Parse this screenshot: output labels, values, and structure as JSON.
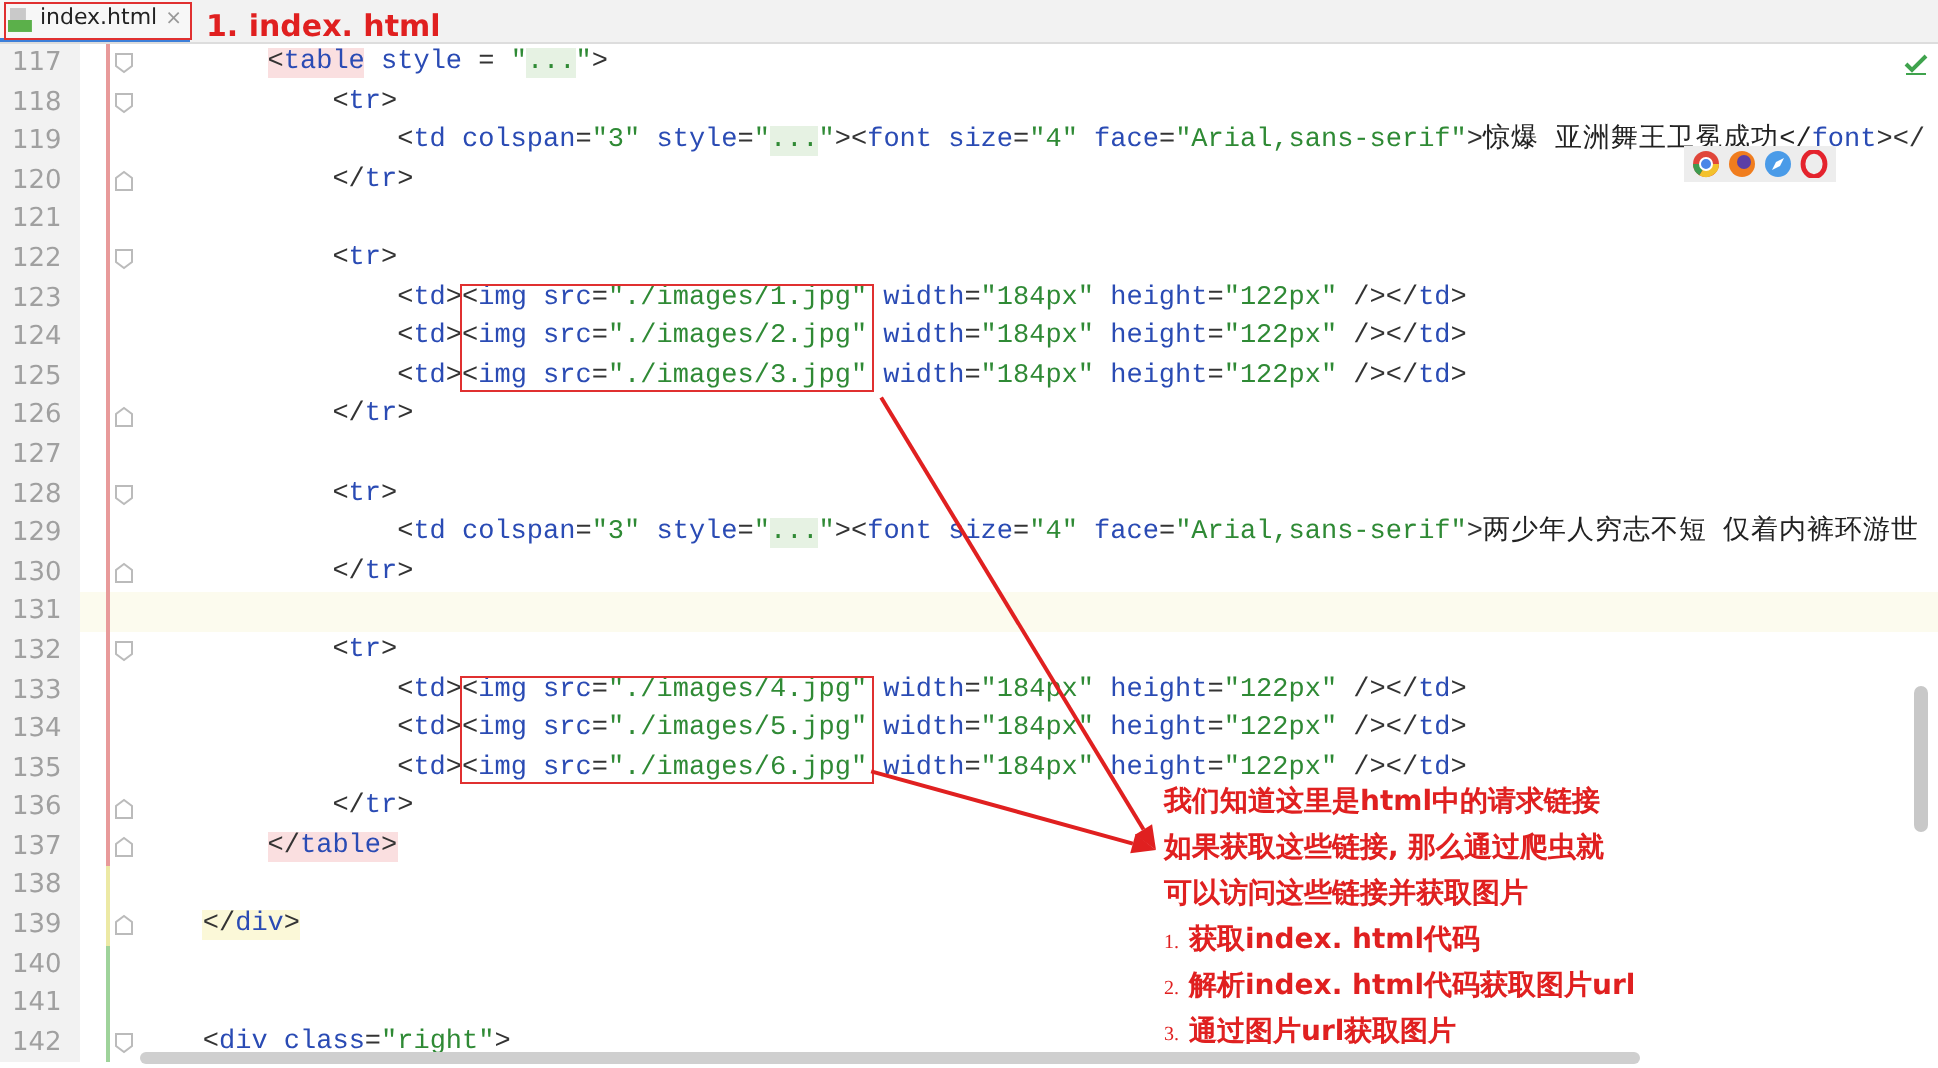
{
  "tab": {
    "label": "index.html",
    "close": "×",
    "selected": true
  },
  "heading": "1. index. html",
  "editor": {
    "lines": [
      {
        "children": [
          {
            "number": "117",
            "color": "#e89a9a",
            "fold_start": true,
            "fold_end": false,
            "current": false,
            "tokens": [
              {
                "kind": "punct",
                "text": "<",
                "color": "#fadfe0"
              },
              {
                "kind": "name",
                "text": "table",
                "color": "#fadfe0"
              },
              {
                "kind": "name",
                "text": " style"
              },
              {
                "kind": "punct",
                "text": " = "
              },
              {
                "kind": "string",
                "text": "\""
              },
              {
                "kind": "fold",
                "text": "..."
              },
              {
                "kind": "string",
                "text": "\""
              },
              {
                "kind": "punct",
                "text": ">"
              }
            ],
            "children": [
              {
                "number": "118",
                "color": "#e89a9a",
                "fold_start": true,
                "fold_end": false,
                "current": false,
                "tokens": [
                  {
                    "kind": "punct",
                    "text": "<"
                  },
                  {
                    "kind": "name",
                    "text": "tr"
                  },
                  {
                    "kind": "punct",
                    "text": ">"
                  }
                ],
                "children": [
                  {
                    "number": "119",
                    "color": "#e89a9a",
                    "fold_start": false,
                    "fold_end": false,
                    "current": false,
                    "tokens": [
                      {
                        "kind": "punct",
                        "text": "<"
                      },
                      {
                        "kind": "name",
                        "text": "td"
                      },
                      {
                        "kind": "name",
                        "text": " colspan"
                      },
                      {
                        "kind": "punct",
                        "text": "="
                      },
                      {
                        "kind": "string",
                        "text": "\"3\""
                      },
                      {
                        "kind": "name",
                        "text": " style"
                      },
                      {
                        "kind": "punct",
                        "text": "="
                      },
                      {
                        "kind": "string",
                        "text": "\""
                      },
                      {
                        "kind": "fold",
                        "text": "..."
                      },
                      {
                        "kind": "string",
                        "text": "\""
                      },
                      {
                        "kind": "punct",
                        "text": "><"
                      },
                      {
                        "kind": "name",
                        "text": "font"
                      },
                      {
                        "kind": "name",
                        "text": " size"
                      },
                      {
                        "kind": "punct",
                        "text": "="
                      },
                      {
                        "kind": "string",
                        "text": "\"4\""
                      },
                      {
                        "kind": "name",
                        "text": " face"
                      },
                      {
                        "kind": "punct",
                        "text": "="
                      },
                      {
                        "kind": "string",
                        "text": "\"Arial,sans-serif\""
                      },
                      {
                        "kind": "punct",
                        "text": ">"
                      },
                      {
                        "kind": "text",
                        "text": "惊爆 亚洲舞王卫冕成功</"
                      },
                      {
                        "kind": "name",
                        "text": "font"
                      },
                      {
                        "kind": "punct",
                        "text": "></"
                      }
                    ]
                  }
                ]
              },
              {
                "number": "120",
                "color": "#e89a9a",
                "fold_start": false,
                "fold_end": true,
                "current": false,
                "tokens": [
                  {
                    "kind": "punct",
                    "text": "</"
                  },
                  {
                    "kind": "name",
                    "text": "tr"
                  },
                  {
                    "kind": "punct",
                    "text": ">"
                  }
                ]
              },
              {
                "number": "121",
                "color": "#e89a9a",
                "fold_start": false,
                "fold_end": false,
                "current": false
              },
              {
                "number": "122",
                "color": "#e89a9a",
                "fold_start": true,
                "fold_end": false,
                "current": false,
                "tokens": [
                  {
                    "kind": "punct",
                    "text": "<"
                  },
                  {
                    "kind": "name",
                    "text": "tr"
                  },
                  {
                    "kind": "punct",
                    "text": ">"
                  }
                ],
                "children": [
                  {
                    "number": "123",
                    "color": "#e89a9a",
                    "fold_start": false,
                    "fold_end": false,
                    "current": false,
                    "tokens": [
                      {
                        "kind": "punct",
                        "text": "<"
                      },
                      {
                        "kind": "name",
                        "text": "td"
                      },
                      {
                        "kind": "punct",
                        "text": ">"
                      },
                      {
                        "kind": "punct",
                        "text": "<",
                        "boxed": true
                      },
                      {
                        "kind": "name",
                        "text": "img",
                        "boxed": true
                      },
                      {
                        "kind": "name",
                        "text": " src",
                        "boxed": true
                      },
                      {
                        "kind": "punct",
                        "text": "=",
                        "boxed": true
                      },
                      {
                        "kind": "string",
                        "text": "\"./images/1.jpg\"",
                        "boxed": true
                      },
                      {
                        "kind": "name",
                        "text": " width"
                      },
                      {
                        "kind": "punct",
                        "text": "="
                      },
                      {
                        "kind": "string",
                        "text": "\"184px\""
                      },
                      {
                        "kind": "name",
                        "text": " height"
                      },
                      {
                        "kind": "punct",
                        "text": "="
                      },
                      {
                        "kind": "string",
                        "text": "\"122px\""
                      },
                      {
                        "kind": "punct",
                        "text": " /></"
                      },
                      {
                        "kind": "name",
                        "text": "td"
                      },
                      {
                        "kind": "punct",
                        "text": ">"
                      }
                    ]
                  },
                  {
                    "number": "124",
                    "color": "#e89a9a",
                    "fold_start": false,
                    "fold_end": false,
                    "current": false,
                    "tokens": [
                      {
                        "kind": "punct",
                        "text": "<"
                      },
                      {
                        "kind": "name",
                        "text": "td"
                      },
                      {
                        "kind": "punct",
                        "text": ">"
                      },
                      {
                        "kind": "punct",
                        "text": "<",
                        "boxed": true
                      },
                      {
                        "kind": "name",
                        "text": "img",
                        "boxed": true
                      },
                      {
                        "kind": "name",
                        "text": " src",
                        "boxed": true
                      },
                      {
                        "kind": "punct",
                        "text": "=",
                        "boxed": true
                      },
                      {
                        "kind": "string",
                        "text": "\"./images/2.jpg\"",
                        "boxed": true
                      },
                      {
                        "kind": "name",
                        "text": " width"
                      },
                      {
                        "kind": "punct",
                        "text": "="
                      },
                      {
                        "kind": "string",
                        "text": "\"184px\""
                      },
                      {
                        "kind": "name",
                        "text": " height"
                      },
                      {
                        "kind": "punct",
                        "text": "="
                      },
                      {
                        "kind": "string",
                        "text": "\"122px\""
                      },
                      {
                        "kind": "punct",
                        "text": " /></"
                      },
                      {
                        "kind": "name",
                        "text": "td"
                      },
                      {
                        "kind": "punct",
                        "text": ">"
                      }
                    ]
                  },
                  {
                    "number": "125",
                    "color": "#e89a9a",
                    "fold_start": false,
                    "fold_end": false,
                    "current": false,
                    "tokens": [
                      {
                        "kind": "punct",
                        "text": "<"
                      },
                      {
                        "kind": "name",
                        "text": "td"
                      },
                      {
                        "kind": "punct",
                        "text": ">"
                      },
                      {
                        "kind": "punct",
                        "text": "<",
                        "boxed": true
                      },
                      {
                        "kind": "name",
                        "text": "img",
                        "boxed": true
                      },
                      {
                        "kind": "name",
                        "text": " src",
                        "boxed": true
                      },
                      {
                        "kind": "punct",
                        "text": "=",
                        "boxed": true
                      },
                      {
                        "kind": "string",
                        "text": "\"./images/3.jpg\"",
                        "boxed": true
                      },
                      {
                        "kind": "name",
                        "text": " width"
                      },
                      {
                        "kind": "punct",
                        "text": "="
                      },
                      {
                        "kind": "string",
                        "text": "\"184px\""
                      },
                      {
                        "kind": "name",
                        "text": " height"
                      },
                      {
                        "kind": "punct",
                        "text": "="
                      },
                      {
                        "kind": "string",
                        "text": "\"122px\""
                      },
                      {
                        "kind": "punct",
                        "text": " /></"
                      },
                      {
                        "kind": "name",
                        "text": "td"
                      },
                      {
                        "kind": "punct",
                        "text": ">"
                      }
                    ]
                  }
                ]
              },
              {
                "number": "126",
                "color": "#e89a9a",
                "fold_start": false,
                "fold_end": true,
                "current": false,
                "tokens": [
                  {
                    "kind": "punct",
                    "text": "</"
                  },
                  {
                    "kind": "name",
                    "text": "tr"
                  },
                  {
                    "kind": "punct",
                    "text": ">"
                  }
                ]
              },
              {
                "number": "127",
                "color": "#e89a9a",
                "fold_start": false,
                "fold_end": false,
                "current": false
              },
              {
                "number": "128",
                "color": "#e89a9a",
                "fold_start": true,
                "fold_end": false,
                "current": false,
                "tokens": [
                  {
                    "kind": "punct",
                    "text": "<"
                  },
                  {
                    "kind": "name",
                    "text": "tr"
                  },
                  {
                    "kind": "punct",
                    "text": ">"
                  }
                ],
                "children": [
                  {
                    "number": "129",
                    "color": "#e89a9a",
                    "fold_start": false,
                    "fold_end": false,
                    "current": false,
                    "tokens": [
                      {
                        "kind": "punct",
                        "text": "<"
                      },
                      {
                        "kind": "name",
                        "text": "td"
                      },
                      {
                        "kind": "name",
                        "text": " colspan"
                      },
                      {
                        "kind": "punct",
                        "text": "="
                      },
                      {
                        "kind": "string",
                        "text": "\"3\""
                      },
                      {
                        "kind": "name",
                        "text": " style"
                      },
                      {
                        "kind": "punct",
                        "text": "="
                      },
                      {
                        "kind": "string",
                        "text": "\""
                      },
                      {
                        "kind": "fold",
                        "text": "..."
                      },
                      {
                        "kind": "string",
                        "text": "\""
                      },
                      {
                        "kind": "punct",
                        "text": "><"
                      },
                      {
                        "kind": "name",
                        "text": "font"
                      },
                      {
                        "kind": "name",
                        "text": " size"
                      },
                      {
                        "kind": "punct",
                        "text": "="
                      },
                      {
                        "kind": "string",
                        "text": "\"4\""
                      },
                      {
                        "kind": "name",
                        "text": " face"
                      },
                      {
                        "kind": "punct",
                        "text": "="
                      },
                      {
                        "kind": "string",
                        "text": "\"Arial,sans-serif\""
                      },
                      {
                        "kind": "punct",
                        "text": ">"
                      },
                      {
                        "kind": "text",
                        "text": "两少年人穷志不短 仅着内裤环游世"
                      }
                    ]
                  }
                ]
              },
              {
                "number": "130",
                "color": "#e89a9a",
                "fold_start": false,
                "fold_end": true,
                "current": false,
                "tokens": [
                  {
                    "kind": "punct",
                    "text": "</"
                  },
                  {
                    "kind": "name",
                    "text": "tr"
                  },
                  {
                    "kind": "punct",
                    "text": ">"
                  }
                ]
              },
              {
                "number": "131",
                "color": "#e89a9a",
                "fold_start": false,
                "fold_end": false,
                "current": true
              },
              {
                "number": "132",
                "color": "#e89a9a",
                "fold_start": true,
                "fold_end": false,
                "current": false,
                "tokens": [
                  {
                    "kind": "punct",
                    "text": "<"
                  },
                  {
                    "kind": "name",
                    "text": "tr"
                  },
                  {
                    "kind": "punct",
                    "text": ">"
                  }
                ],
                "children": [
                  {
                    "number": "133",
                    "color": "#e89a9a",
                    "fold_start": false,
                    "fold_end": false,
                    "current": false,
                    "tokens": [
                      {
                        "kind": "punct",
                        "text": "<"
                      },
                      {
                        "kind": "name",
                        "text": "td"
                      },
                      {
                        "kind": "punct",
                        "text": ">"
                      },
                      {
                        "kind": "punct",
                        "text": "<",
                        "boxed": true
                      },
                      {
                        "kind": "name",
                        "text": "img",
                        "boxed": true
                      },
                      {
                        "kind": "name",
                        "text": " src",
                        "boxed": true
                      },
                      {
                        "kind": "punct",
                        "text": "=",
                        "boxed": true
                      },
                      {
                        "kind": "string",
                        "text": "\"./images/4.jpg\"",
                        "boxed": true
                      },
                      {
                        "kind": "name",
                        "text": " width"
                      },
                      {
                        "kind": "punct",
                        "text": "="
                      },
                      {
                        "kind": "string",
                        "text": "\"184px\""
                      },
                      {
                        "kind": "name",
                        "text": " height"
                      },
                      {
                        "kind": "punct",
                        "text": "="
                      },
                      {
                        "kind": "string",
                        "text": "\"122px\""
                      },
                      {
                        "kind": "punct",
                        "text": " /></"
                      },
                      {
                        "kind": "name",
                        "text": "td"
                      },
                      {
                        "kind": "punct",
                        "text": ">"
                      }
                    ]
                  },
                  {
                    "number": "134",
                    "color": "#e89a9a",
                    "fold_start": false,
                    "fold_end": false,
                    "current": false,
                    "tokens": [
                      {
                        "kind": "punct",
                        "text": "<"
                      },
                      {
                        "kind": "name",
                        "text": "td"
                      },
                      {
                        "kind": "punct",
                        "text": ">"
                      },
                      {
                        "kind": "punct",
                        "text": "<",
                        "boxed": true
                      },
                      {
                        "kind": "name",
                        "text": "img",
                        "boxed": true
                      },
                      {
                        "kind": "name",
                        "text": " src",
                        "boxed": true
                      },
                      {
                        "kind": "punct",
                        "text": "=",
                        "boxed": true
                      },
                      {
                        "kind": "string",
                        "text": "\"./images/5.jpg\"",
                        "boxed": true
                      },
                      {
                        "kind": "name",
                        "text": " width"
                      },
                      {
                        "kind": "punct",
                        "text": "="
                      },
                      {
                        "kind": "string",
                        "text": "\"184px\""
                      },
                      {
                        "kind": "name",
                        "text": " height"
                      },
                      {
                        "kind": "punct",
                        "text": "="
                      },
                      {
                        "kind": "string",
                        "text": "\"122px\""
                      },
                      {
                        "kind": "punct",
                        "text": " /></"
                      },
                      {
                        "kind": "name",
                        "text": "td"
                      },
                      {
                        "kind": "punct",
                        "text": ">"
                      }
                    ]
                  },
                  {
                    "number": "135",
                    "color": "#e89a9a",
                    "fold_start": false,
                    "fold_end": false,
                    "current": false,
                    "tokens": [
                      {
                        "kind": "punct",
                        "text": "<"
                      },
                      {
                        "kind": "name",
                        "text": "td"
                      },
                      {
                        "kind": "punct",
                        "text": ">"
                      },
                      {
                        "kind": "punct",
                        "text": "<",
                        "boxed": true
                      },
                      {
                        "kind": "name",
                        "text": "img",
                        "boxed": true
                      },
                      {
                        "kind": "name",
                        "text": " src",
                        "boxed": true
                      },
                      {
                        "kind": "punct",
                        "text": "=",
                        "boxed": true
                      },
                      {
                        "kind": "string",
                        "text": "\"./images/6.jpg\"",
                        "boxed": true
                      },
                      {
                        "kind": "name",
                        "text": " width"
                      },
                      {
                        "kind": "punct",
                        "text": "="
                      },
                      {
                        "kind": "string",
                        "text": "\"184px\""
                      },
                      {
                        "kind": "name",
                        "text": " height"
                      },
                      {
                        "kind": "punct",
                        "text": "="
                      },
                      {
                        "kind": "string",
                        "text": "\"122px\""
                      },
                      {
                        "kind": "punct",
                        "text": " /></"
                      },
                      {
                        "kind": "name",
                        "text": "td"
                      },
                      {
                        "kind": "punct",
                        "text": ">"
                      }
                    ]
                  }
                ]
              },
              {
                "number": "136",
                "color": "#e89a9a",
                "fold_start": false,
                "fold_end": true,
                "current": false,
                "tokens": [
                  {
                    "kind": "punct",
                    "text": "</"
                  },
                  {
                    "kind": "name",
                    "text": "tr"
                  },
                  {
                    "kind": "punct",
                    "text": ">"
                  }
                ]
              }
            ]
          },
          {
            "number": "137",
            "color": "#e89a9a",
            "fold_start": false,
            "fold_end": true,
            "current": false,
            "tokens": [
              {
                "kind": "punct",
                "text": "</",
                "color": "#fadfe0"
              },
              {
                "kind": "name",
                "text": "table",
                "color": "#fadfe0"
              },
              {
                "kind": "punct",
                "text": ">",
                "color": "#fadfe0"
              }
            ]
          }
        ]
      },
      {
        "number": "138",
        "color": "#ece9a5",
        "fold_start": false,
        "fold_end": false,
        "current": false
      },
      {
        "number": "139",
        "color": "#ece9a5",
        "fold_start": false,
        "fold_end": true,
        "current": false,
        "tokens": [
          {
            "kind": "punct",
            "text": "</",
            "color": "#fbf8d8"
          },
          {
            "kind": "name",
            "text": "div",
            "color": "#fbf8d8"
          },
          {
            "kind": "punct",
            "text": ">",
            "color": "#fbf8d8"
          }
        ]
      },
      {
        "number": "140",
        "color": "#9fd39b",
        "fold_start": false,
        "fold_end": false,
        "current": false
      },
      {
        "number": "141",
        "color": "#9fd39b",
        "fold_start": false,
        "fold_end": false,
        "current": false
      },
      {
        "number": "142",
        "color": "#9fd39b",
        "fold_start": true,
        "fold_end": false,
        "current": false,
        "tokens": [
          {
            "kind": "punct",
            "text": "<"
          },
          {
            "kind": "name",
            "text": "div"
          },
          {
            "kind": "name",
            "text": " class"
          },
          {
            "kind": "punct",
            "text": "="
          },
          {
            "kind": "string",
            "text": "\"right\""
          },
          {
            "kind": "punct",
            "text": ">"
          }
        ]
      }
    ]
  },
  "notes": {
    "lines": [
      "我们知道这里是html中的请求链接",
      "如果获取这些链接, 那么通过爬虫就",
      "可以访问这些链接并获取图片"
    ],
    "steps": [
      {
        "number": "1.",
        "text": "获取index. html代码"
      },
      {
        "number": "2.",
        "text": "解析index. html代码获取图片url"
      },
      {
        "number": "3.",
        "text": "通过图片url获取图片"
      }
    ]
  }
}
